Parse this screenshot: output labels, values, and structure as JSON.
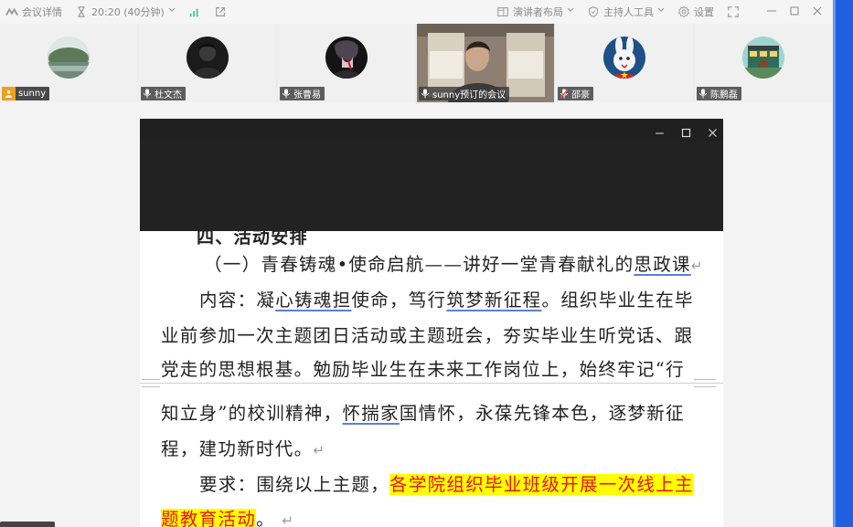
{
  "topbar": {
    "meeting_details": "会议详情",
    "timer": "20:20 (40分钟)",
    "presenter_layout": "演讲者布局",
    "host_tools": "主持人工具",
    "settings": "设置"
  },
  "participants": [
    {
      "name": "sunny",
      "role": "host"
    },
    {
      "name": "杜文杰",
      "role": "muted"
    },
    {
      "name": "张曹易",
      "role": "muted"
    },
    {
      "name": "sunny预订的会议",
      "role": "video"
    },
    {
      "name": "邵豪",
      "role": "mic-off"
    },
    {
      "name": "陈鹏磊",
      "role": "muted"
    }
  ],
  "document": {
    "heading_partial": "四、活动安排",
    "l1": "（一）青春铸魂•使命启航——讲好一堂青春献礼的",
    "l1_u": "思政课",
    "l2_a": "内容：凝",
    "l2_u1": "心铸魂担",
    "l2_b": "使命，笃行",
    "l2_u2": "筑梦新征程",
    "l2_c": "。组织毕业生在毕",
    "l3": "业前参加一次主题团日活动或主题班会，夯实毕业生听党话、跟",
    "l4": "党走的思想根基。勉励毕业生在未来工作岗位上，始终牢记“行",
    "l5_a": "知立身”的校训精神，",
    "l5_u": "怀揣家",
    "l5_b": "国情怀，永葆先锋本色，逐梦新征",
    "l6": "程，建功新时代。",
    "l7_a": "要求：围绕以上主题，",
    "l7_hl": "各学院组织毕业班级开展一次线上主",
    "l8_hl": "题教育活动",
    "l8_b": "。",
    "para_mark": "↵"
  }
}
